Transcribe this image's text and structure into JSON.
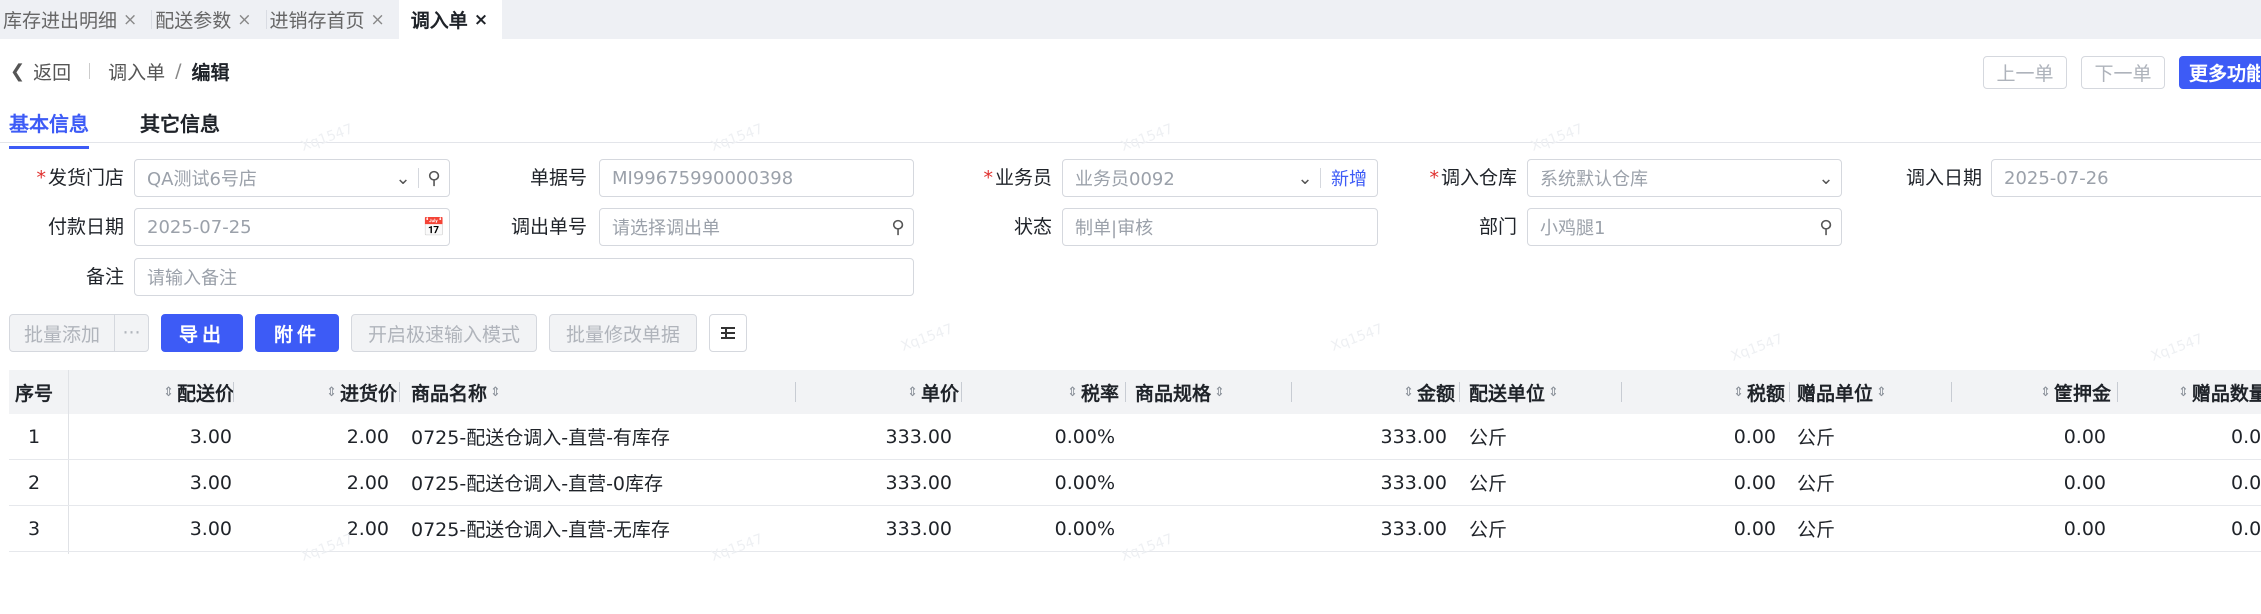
{
  "tabs": [
    {
      "label": "库存进出明细",
      "active": false
    },
    {
      "label": "配送参数",
      "active": false
    },
    {
      "label": "进销存首页",
      "active": false
    },
    {
      "label": "调入单",
      "active": true
    }
  ],
  "tab_close_glyph": "×",
  "breadcrumb": {
    "back": "返回",
    "parent": "调入单",
    "separator": "/",
    "current": "编辑"
  },
  "nav": {
    "prev": "上一单",
    "next": "下一单",
    "more": "更多功能"
  },
  "section_tabs": {
    "basic": "基本信息",
    "other": "其它信息"
  },
  "form": {
    "store": {
      "label": "发货门店",
      "value": "QA测试6号店"
    },
    "doc_no": {
      "label": "单据号",
      "value": "MI99675990000398"
    },
    "salesman": {
      "label": "业务员",
      "value": "业务员0092",
      "add": "新增"
    },
    "in_warehouse": {
      "label": "调入仓库",
      "value": "系统默认仓库"
    },
    "in_date": {
      "label": "调入日期",
      "value": "2025-07-26"
    },
    "pay_date": {
      "label": "付款日期",
      "value": "2025-07-25"
    },
    "out_no": {
      "label": "调出单号",
      "placeholder": "请选择调出单"
    },
    "status": {
      "label": "状态",
      "value": "制单|审核"
    },
    "dept": {
      "label": "部门",
      "value": "小鸡腿1"
    },
    "remark": {
      "label": "备注",
      "placeholder": "请输入备注"
    }
  },
  "toolbar": {
    "batch_add": "批量添加",
    "more": "···",
    "export": "导出",
    "attach": "附件",
    "fast_mode": "开启极速输入模式",
    "batch_edit": "批量修改单据"
  },
  "table": {
    "headers": {
      "seq": "序号",
      "dist_price": "配送价",
      "purchase_price": "进货价",
      "name": "商品名称",
      "unit_price": "单价",
      "tax_rate": "税率",
      "spec": "商品规格",
      "amount": "金额",
      "dist_unit": "配送单位",
      "tax": "税额",
      "gift_unit": "赠品单位",
      "deposit": "筐押金",
      "gift_qty": "赠品数量"
    },
    "rows": [
      {
        "seq": "1",
        "dist_price": "3.00",
        "purchase_price": "2.00",
        "name": "0725-配送仓调入-直营-有库存",
        "unit_price": "333.00",
        "tax_rate": "0.00%",
        "amount": "333.00",
        "dist_unit": "公斤",
        "tax": "0.00",
        "gift_unit": "公斤",
        "deposit": "0.00",
        "gift_qty": "0.00"
      },
      {
        "seq": "2",
        "dist_price": "3.00",
        "purchase_price": "2.00",
        "name": "0725-配送仓调入-直营-0库存",
        "unit_price": "333.00",
        "tax_rate": "0.00%",
        "amount": "333.00",
        "dist_unit": "公斤",
        "tax": "0.00",
        "gift_unit": "公斤",
        "deposit": "0.00",
        "gift_qty": "0.00"
      },
      {
        "seq": "3",
        "dist_price": "3.00",
        "purchase_price": "2.00",
        "name": "0725-配送仓调入-直营-无库存",
        "unit_price": "333.00",
        "tax_rate": "0.00%",
        "amount": "333.00",
        "dist_unit": "公斤",
        "tax": "0.00",
        "gift_unit": "公斤",
        "deposit": "0.00",
        "gift_qty": "0.00"
      }
    ]
  },
  "watermark": "Xq1547",
  "colors": {
    "accent": "#3d5bf6",
    "required": "#e0302e",
    "tab_bg": "#eef0f4",
    "header_bg": "#f2f3f5"
  }
}
